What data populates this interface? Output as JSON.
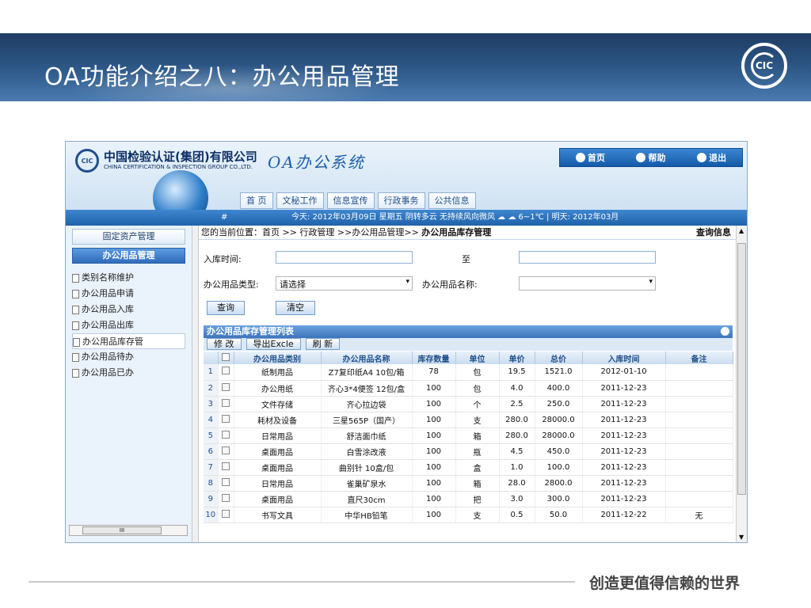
{
  "slide": {
    "title": "OA功能介绍之八：办公用品管理",
    "logo_text": "CIC",
    "slogan": "创造更值得信赖的世界"
  },
  "app": {
    "company_cn": "中国检验认证(集团)有限公司",
    "company_en": "CHINA CERTIFICATION & INSPECTION GROUP CO.,LTD.",
    "system_name": "OA办公系统"
  },
  "topbar": {
    "home": "首页",
    "help": "帮助",
    "logout": "退出"
  },
  "nav": {
    "tabs": [
      "首 页",
      "文秘工作",
      "信息宣传",
      "行政事务",
      "公共信息"
    ]
  },
  "status": {
    "hash": "#",
    "weather": "今天: 2012年03月09日 星期五 阴转多云 无持续风向微风 ☁ ☁ 6~1℃ | 明天: 2012年03月"
  },
  "sidebar": {
    "cat1": "固定资产管理",
    "cat2": "办公用品管理",
    "items": [
      "类别名称维护",
      "办公用品申请",
      "办公用品入库",
      "办公用品出库",
      "办公用品库存管",
      "办公用品待办",
      "办公用品已办"
    ],
    "scroll_label": "III"
  },
  "breadcrumb": {
    "text": "您的当前位置：首页 >> 行政管理 >>办公用品管理>> ",
    "current": "办公用品库存管理",
    "query_info": "查询信息"
  },
  "form": {
    "date_label": "入库时间:",
    "to_label": "至",
    "type_label": "办公用品类型:",
    "type_value": "请选择",
    "name_label": "办公用品名称:",
    "name_value": "",
    "query_btn": "查询",
    "clear_btn": "清空"
  },
  "grid": {
    "title": "办公用品库存管理列表",
    "buttons": [
      "修 改",
      "导出Excle",
      "刷 新"
    ],
    "headers": [
      "",
      "",
      "办公用品类别",
      "办公用品名称",
      "库存数量",
      "单位",
      "单价",
      "总价",
      "入库时间",
      "备注"
    ],
    "rows": [
      [
        "1",
        "",
        "纸制用品",
        "Z7复印纸A4 10包/箱",
        "78",
        "包",
        "19.5",
        "1521.0",
        "2012-01-10",
        ""
      ],
      [
        "2",
        "",
        "办公用纸",
        "齐心3*4便签 12包/盒",
        "100",
        "包",
        "4.0",
        "400.0",
        "2011-12-23",
        ""
      ],
      [
        "3",
        "",
        "文件存储",
        "齐心拉边袋",
        "100",
        "个",
        "2.5",
        "250.0",
        "2011-12-23",
        ""
      ],
      [
        "4",
        "",
        "耗材及设备",
        "三星565P（国产）",
        "100",
        "支",
        "280.0",
        "28000.0",
        "2011-12-23",
        ""
      ],
      [
        "5",
        "",
        "日常用品",
        "舒洁面巾纸",
        "100",
        "箱",
        "280.0",
        "28000.0",
        "2011-12-23",
        ""
      ],
      [
        "6",
        "",
        "桌面用品",
        "白雪涂改液",
        "100",
        "瓶",
        "4.5",
        "450.0",
        "2011-12-23",
        ""
      ],
      [
        "7",
        "",
        "桌面用品",
        "曲别针 10盒/包",
        "100",
        "盒",
        "1.0",
        "100.0",
        "2011-12-23",
        ""
      ],
      [
        "8",
        "",
        "日常用品",
        "雀巢矿泉水",
        "100",
        "箱",
        "28.0",
        "2800.0",
        "2011-12-23",
        ""
      ],
      [
        "9",
        "",
        "桌面用品",
        "直尺30cm",
        "100",
        "把",
        "3.0",
        "300.0",
        "2011-12-23",
        ""
      ],
      [
        "10",
        "",
        "书写文具",
        "中华HB铅笔",
        "100",
        "支",
        "0.5",
        "50.0",
        "2011-12-22",
        "无"
      ]
    ]
  }
}
